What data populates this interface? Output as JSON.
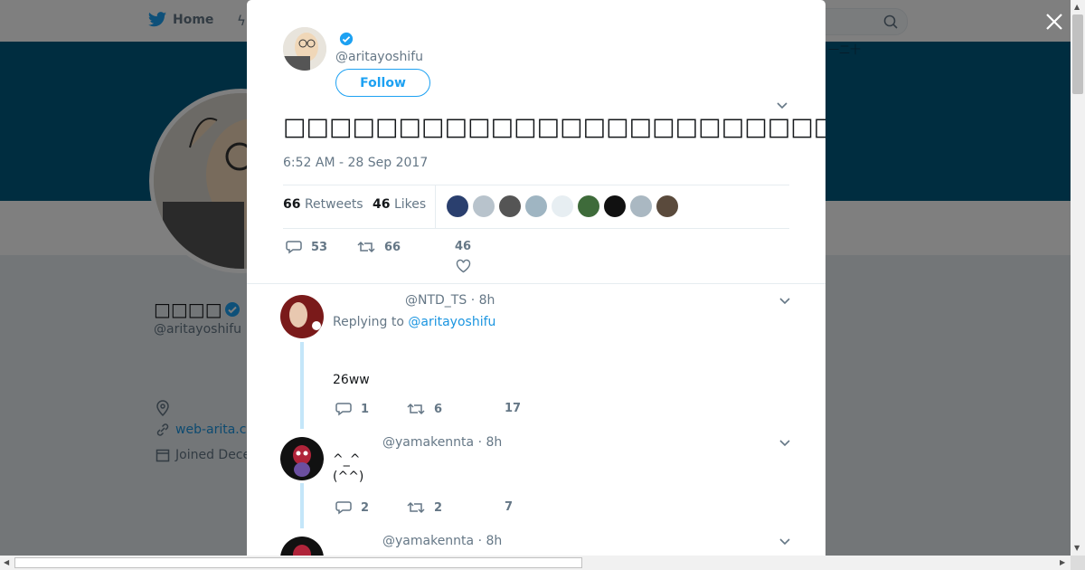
{
  "nav": {
    "home_label": "Home",
    "search_placeholder": ""
  },
  "profile": {
    "name": "□□□□",
    "handle": "@aritayoshifu",
    "link_text": "web-arita.co",
    "joined_text": "Joined Dece",
    "banner_text": "一二十"
  },
  "tweet": {
    "handle": "@aritayoshifu",
    "follow_label": "Follow",
    "text": "□□□□□□□□□□□□□□□□□□□□□□□□□□□□□□□□□□□□□□□□□□□□□□□□□□",
    "timestamp": "6:52 AM - 28 Sep 2017",
    "retweets_count": "66",
    "retweets_label": "Retweets",
    "likes_count": "46",
    "likes_label": "Likes",
    "likers_colors": [
      "#2a3f6e",
      "#b8c3cc",
      "#555555",
      "#9fb5c2",
      "#e7eef2",
      "#3e6b3a",
      "#111111",
      "#aab8c2",
      "#5a4a3c"
    ],
    "actions": {
      "replies": "53",
      "retweets": "66",
      "likes": "46"
    }
  },
  "replies": [
    {
      "handle_line": "@NTD_TS · 8h",
      "replying_prefix": "Replying to",
      "replying_to": "@aritayoshifu",
      "text": "26ww",
      "counts": {
        "replies": "1",
        "retweets": "6",
        "likes": "17"
      }
    },
    {
      "handle_line": "@yamakennta · 8h",
      "text_line1": "^_^",
      "text_line2": "(^^)",
      "counts": {
        "replies": "2",
        "retweets": "2",
        "likes": "7"
      }
    },
    {
      "handle_line": "@yamakennta · 8h"
    }
  ],
  "colors": {
    "accent": "#1da1f2",
    "banner": "#005b81",
    "text_secondary": "#657786"
  }
}
